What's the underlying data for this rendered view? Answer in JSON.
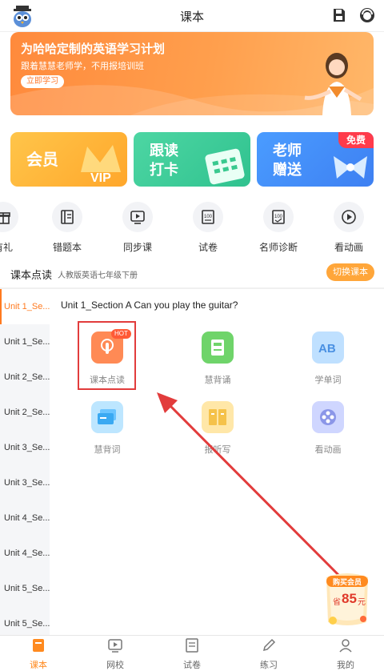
{
  "header": {
    "title": "课本"
  },
  "banner": {
    "title": "为哈哈定制的英语学习计划",
    "subtitle": "跟着慧慧老师学，不用报培训班",
    "button": "立即学习"
  },
  "cards": [
    {
      "label": "会员",
      "extra": "VIP"
    },
    {
      "label_line1": "跟读",
      "label_line2": "打卡"
    },
    {
      "label_line1": "老师",
      "label_line2": "赠送",
      "badge": "免费"
    }
  ],
  "quick_icons": [
    "有礼",
    "错题本",
    "同步课",
    "试卷",
    "名师诊断",
    "看动画"
  ],
  "textbook": {
    "title": "课本点读",
    "subtitle": "人教版英语七年级下册",
    "switch": "切换课本"
  },
  "units": [
    "Unit 1_Se...",
    "Unit 1_Se...",
    "Unit 2_Se...",
    "Unit 2_Se...",
    "Unit 3_Se...",
    "Unit 3_Se...",
    "Unit 4_Se...",
    "Unit 4_Se...",
    "Unit 5_Se...",
    "Unit 5_Se..."
  ],
  "content": {
    "heading": "Unit 1_Section A Can you play the guitar?",
    "hot": "HOT",
    "functions": [
      "课本点读",
      "慧背诵",
      "学单词",
      "慧背词",
      "报听写",
      "看动画"
    ]
  },
  "promo": {
    "tag": "购买会员",
    "price_prefix": "省",
    "price": "85",
    "price_unit": "元"
  },
  "nav": [
    "课本",
    "网校",
    "试卷",
    "练习",
    "我的"
  ],
  "colors": {
    "accent": "#ff8a1f",
    "highlight": "#e23c3c"
  }
}
